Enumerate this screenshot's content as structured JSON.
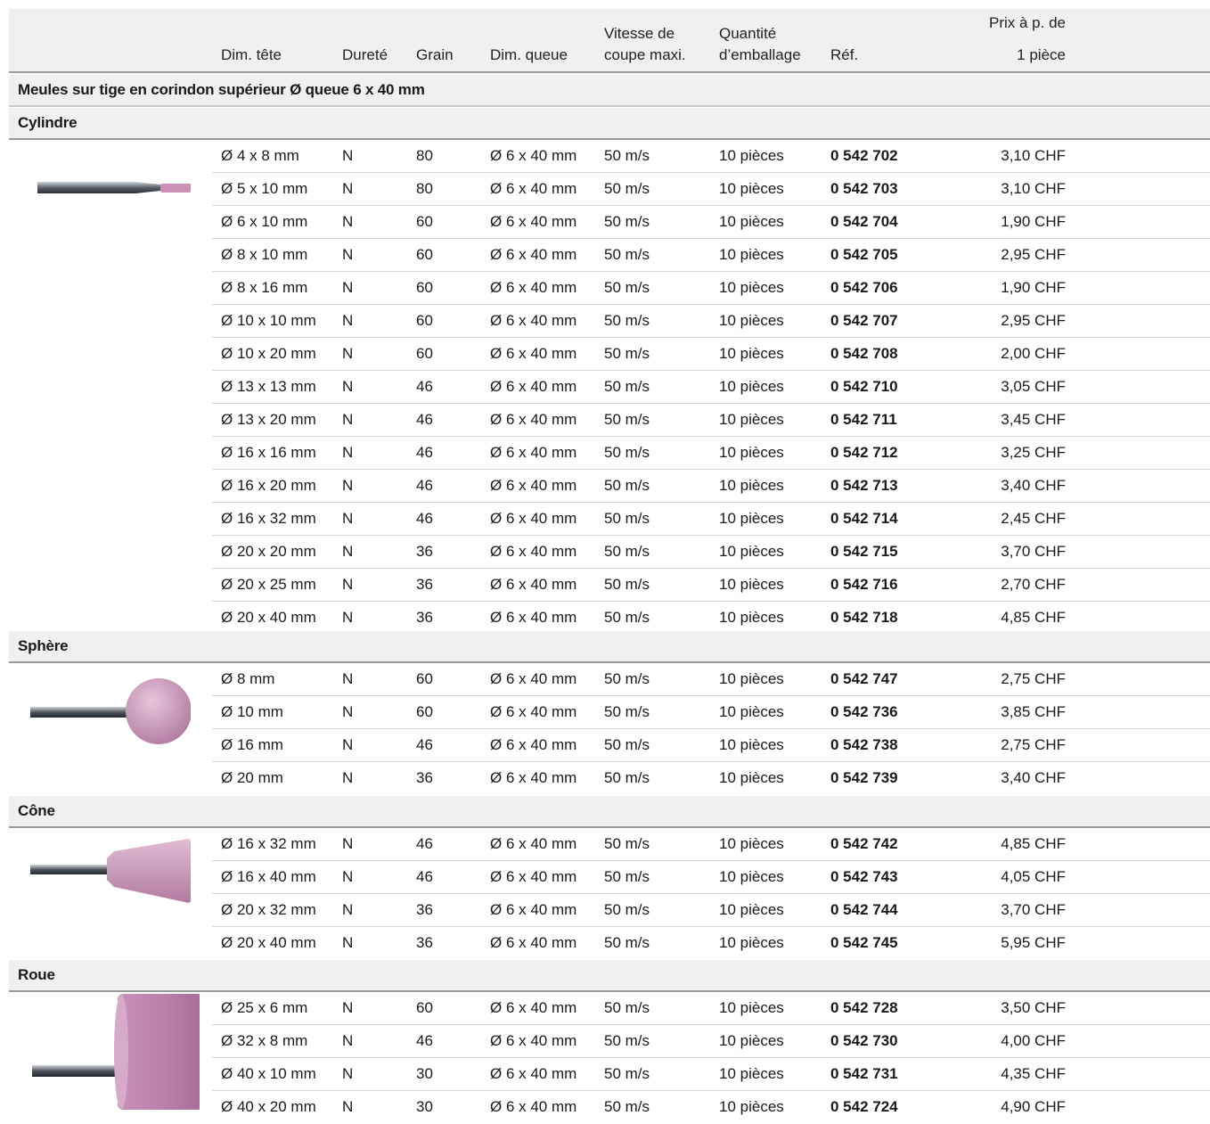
{
  "columns": {
    "dim_tete": "Dim. tête",
    "durete": "Dureté",
    "grain": "Grain",
    "dim_queue": "Dim. queue",
    "vitesse_l1": "Vitesse de",
    "vitesse_l2": "coupe maxi.",
    "quantite_l1": "Quantité",
    "quantite_l2": "d’emballage",
    "ref": "Réf.",
    "prix_l1": "Prix à p. de",
    "prix_l2": "1 pièce"
  },
  "title": "Meules sur tige en corindon supérieur Ø queue 6 x 40 mm",
  "colors": {
    "header_bg": "#f0f0f0",
    "rule": "#9a9a9a",
    "abrasive": "#c98fb5"
  },
  "sections": [
    {
      "name": "Cylindre",
      "icon": "cylinder-point-icon",
      "rows": [
        {
          "dim": "Ø 4 x 8 mm",
          "durete": "N",
          "grain": "80",
          "queue": "Ø 6 x 40 mm",
          "vitesse": "50 m/s",
          "qte": "10 pièces",
          "ref": "0 542 702",
          "prix": "3,10 CHF"
        },
        {
          "dim": "Ø 5 x 10 mm",
          "durete": "N",
          "grain": "80",
          "queue": "Ø 6 x 40 mm",
          "vitesse": "50 m/s",
          "qte": "10 pièces",
          "ref": "0 542 703",
          "prix": "3,10 CHF"
        },
        {
          "dim": "Ø 6 x 10 mm",
          "durete": "N",
          "grain": "60",
          "queue": "Ø 6 x 40 mm",
          "vitesse": "50 m/s",
          "qte": "10 pièces",
          "ref": "0 542 704",
          "prix": "1,90 CHF"
        },
        {
          "dim": "Ø 8 x 10 mm",
          "durete": "N",
          "grain": "60",
          "queue": "Ø 6 x 40 mm",
          "vitesse": "50 m/s",
          "qte": "10 pièces",
          "ref": "0 542 705",
          "prix": "2,95 CHF"
        },
        {
          "dim": "Ø 8 x 16 mm",
          "durete": "N",
          "grain": "60",
          "queue": "Ø 6 x 40 mm",
          "vitesse": "50 m/s",
          "qte": "10 pièces",
          "ref": "0 542 706",
          "prix": "1,90 CHF"
        },
        {
          "dim": "Ø 10 x 10 mm",
          "durete": "N",
          "grain": "60",
          "queue": "Ø 6 x 40 mm",
          "vitesse": "50 m/s",
          "qte": "10 pièces",
          "ref": "0 542 707",
          "prix": "2,95 CHF"
        },
        {
          "dim": "Ø 10 x 20 mm",
          "durete": "N",
          "grain": "60",
          "queue": "Ø 6 x 40 mm",
          "vitesse": "50 m/s",
          "qte": "10 pièces",
          "ref": "0 542 708",
          "prix": "2,00 CHF"
        },
        {
          "dim": "Ø 13 x 13 mm",
          "durete": "N",
          "grain": "46",
          "queue": "Ø 6 x 40 mm",
          "vitesse": "50 m/s",
          "qte": "10 pièces",
          "ref": "0 542 710",
          "prix": "3,05 CHF"
        },
        {
          "dim": "Ø 13 x 20 mm",
          "durete": "N",
          "grain": "46",
          "queue": "Ø 6 x 40 mm",
          "vitesse": "50 m/s",
          "qte": "10 pièces",
          "ref": "0 542 711",
          "prix": "3,45 CHF"
        },
        {
          "dim": "Ø 16 x 16 mm",
          "durete": "N",
          "grain": "46",
          "queue": "Ø 6 x 40 mm",
          "vitesse": "50 m/s",
          "qte": "10 pièces",
          "ref": "0 542 712",
          "prix": "3,25 CHF"
        },
        {
          "dim": "Ø 16 x 20 mm",
          "durete": "N",
          "grain": "46",
          "queue": "Ø 6 x 40 mm",
          "vitesse": "50 m/s",
          "qte": "10 pièces",
          "ref": "0 542 713",
          "prix": "3,40 CHF"
        },
        {
          "dim": "Ø 16 x 32 mm",
          "durete": "N",
          "grain": "46",
          "queue": "Ø 6 x 40 mm",
          "vitesse": "50 m/s",
          "qte": "10 pièces",
          "ref": "0 542 714",
          "prix": "2,45 CHF"
        },
        {
          "dim": "Ø 20 x 20 mm",
          "durete": "N",
          "grain": "36",
          "queue": "Ø 6 x 40 mm",
          "vitesse": "50 m/s",
          "qte": "10 pièces",
          "ref": "0 542 715",
          "prix": "3,70 CHF"
        },
        {
          "dim": "Ø 20 x 25 mm",
          "durete": "N",
          "grain": "36",
          "queue": "Ø 6 x 40 mm",
          "vitesse": "50 m/s",
          "qte": "10 pièces",
          "ref": "0 542 716",
          "prix": "2,70 CHF"
        },
        {
          "dim": "Ø 20 x 40 mm",
          "durete": "N",
          "grain": "36",
          "queue": "Ø 6 x 40 mm",
          "vitesse": "50 m/s",
          "qte": "10 pièces",
          "ref": "0 542 718",
          "prix": "4,85 CHF"
        }
      ]
    },
    {
      "name": "Sphère",
      "icon": "sphere-point-icon",
      "rows": [
        {
          "dim": "Ø 8 mm",
          "durete": "N",
          "grain": "60",
          "queue": "Ø 6 x 40 mm",
          "vitesse": "50 m/s",
          "qte": "10 pièces",
          "ref": "0 542 747",
          "prix": "2,75 CHF"
        },
        {
          "dim": "Ø 10 mm",
          "durete": "N",
          "grain": "60",
          "queue": "Ø 6 x 40 mm",
          "vitesse": "50 m/s",
          "qte": "10 pièces",
          "ref": "0 542 736",
          "prix": "3,85 CHF"
        },
        {
          "dim": "Ø 16 mm",
          "durete": "N",
          "grain": "46",
          "queue": "Ø 6 x 40 mm",
          "vitesse": "50 m/s",
          "qte": "10 pièces",
          "ref": "0 542 738",
          "prix": "2,75 CHF"
        },
        {
          "dim": "Ø 20 mm",
          "durete": "N",
          "grain": "36",
          "queue": "Ø 6 x 40 mm",
          "vitesse": "50 m/s",
          "qte": "10 pièces",
          "ref": "0 542 739",
          "prix": "3,40 CHF"
        }
      ]
    },
    {
      "name": "Cône",
      "icon": "cone-point-icon",
      "rows": [
        {
          "dim": "Ø 16 x 32 mm",
          "durete": "N",
          "grain": "46",
          "queue": "Ø 6 x 40 mm",
          "vitesse": "50 m/s",
          "qte": "10 pièces",
          "ref": "0 542 742",
          "prix": "4,85 CHF"
        },
        {
          "dim": "Ø 16 x 40 mm",
          "durete": "N",
          "grain": "46",
          "queue": "Ø 6 x 40 mm",
          "vitesse": "50 m/s",
          "qte": "10 pièces",
          "ref": "0 542 743",
          "prix": "4,05 CHF"
        },
        {
          "dim": "Ø 20 x 32 mm",
          "durete": "N",
          "grain": "36",
          "queue": "Ø 6 x 40 mm",
          "vitesse": "50 m/s",
          "qte": "10 pièces",
          "ref": "0 542 744",
          "prix": "3,70 CHF"
        },
        {
          "dim": "Ø 20 x 40 mm",
          "durete": "N",
          "grain": "36",
          "queue": "Ø 6 x 40 mm",
          "vitesse": "50 m/s",
          "qte": "10 pièces",
          "ref": "0 542 745",
          "prix": "5,95 CHF"
        }
      ]
    },
    {
      "name": "Roue",
      "icon": "wheel-point-icon",
      "rows": [
        {
          "dim": "Ø 25 x 6 mm",
          "durete": "N",
          "grain": "60",
          "queue": "Ø 6 x 40 mm",
          "vitesse": "50 m/s",
          "qte": "10 pièces",
          "ref": "0 542 728",
          "prix": "3,50 CHF"
        },
        {
          "dim": "Ø 32 x 8 mm",
          "durete": "N",
          "grain": "46",
          "queue": "Ø 6 x 40 mm",
          "vitesse": "50 m/s",
          "qte": "10 pièces",
          "ref": "0 542 730",
          "prix": "4,00 CHF"
        },
        {
          "dim": "Ø 40 x 10 mm",
          "durete": "N",
          "grain": "30",
          "queue": "Ø 6 x 40 mm",
          "vitesse": "50 m/s",
          "qte": "10 pièces",
          "ref": "0 542 731",
          "prix": "4,35 CHF"
        },
        {
          "dim": "Ø 40 x 20 mm",
          "durete": "N",
          "grain": "30",
          "queue": "Ø 6 x 40 mm",
          "vitesse": "50 m/s",
          "qte": "10 pièces",
          "ref": "0 542 724",
          "prix": "4,90 CHF"
        }
      ]
    }
  ]
}
